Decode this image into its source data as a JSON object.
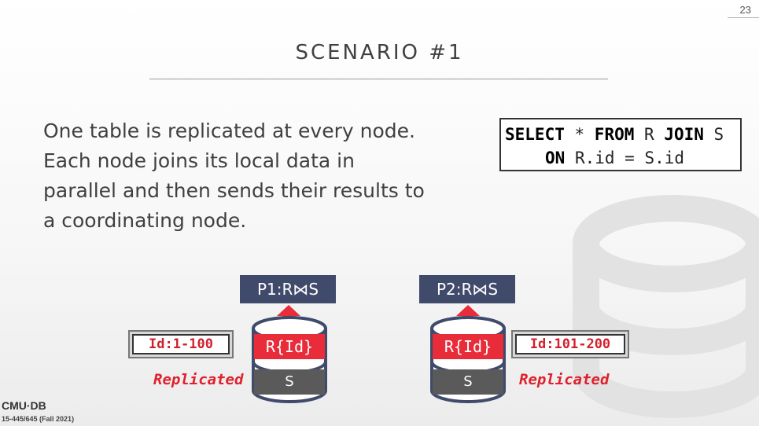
{
  "slide": {
    "number": "23",
    "title": "SCENARIO #1"
  },
  "bullets": [
    "One table is replicated at every node.",
    "Each node joins its local data in parallel and then sends their results to a coordinating node."
  ],
  "sql": {
    "line1": [
      {
        "text": "SELECT",
        "keyword": true
      },
      {
        "text": " * ",
        "keyword": false
      },
      {
        "text": "FROM",
        "keyword": true
      },
      {
        "text": " R ",
        "keyword": false
      },
      {
        "text": "JOIN",
        "keyword": true
      },
      {
        "text": " S",
        "keyword": false
      }
    ],
    "line2": [
      {
        "text": "ON",
        "keyword": true
      },
      {
        "text": " R.id = S.id",
        "keyword": false
      }
    ]
  },
  "partitions": [
    {
      "label": "P1:R⋈S",
      "r_label": "R{Id}",
      "s_label": "S",
      "range": "Id:1-100",
      "tag": "Replicated"
    },
    {
      "label": "P2:R⋈S",
      "r_label": "R{Id}",
      "s_label": "S",
      "range": "Id:101-200",
      "tag": "Replicated"
    }
  ],
  "footer": {
    "logo": "CMU·DB",
    "course": "15-445/645 (Fall 2021)"
  },
  "colors": {
    "accent_red": "#e82c3a",
    "navy": "#404a6b",
    "s_gray": "#5a5a5a"
  }
}
